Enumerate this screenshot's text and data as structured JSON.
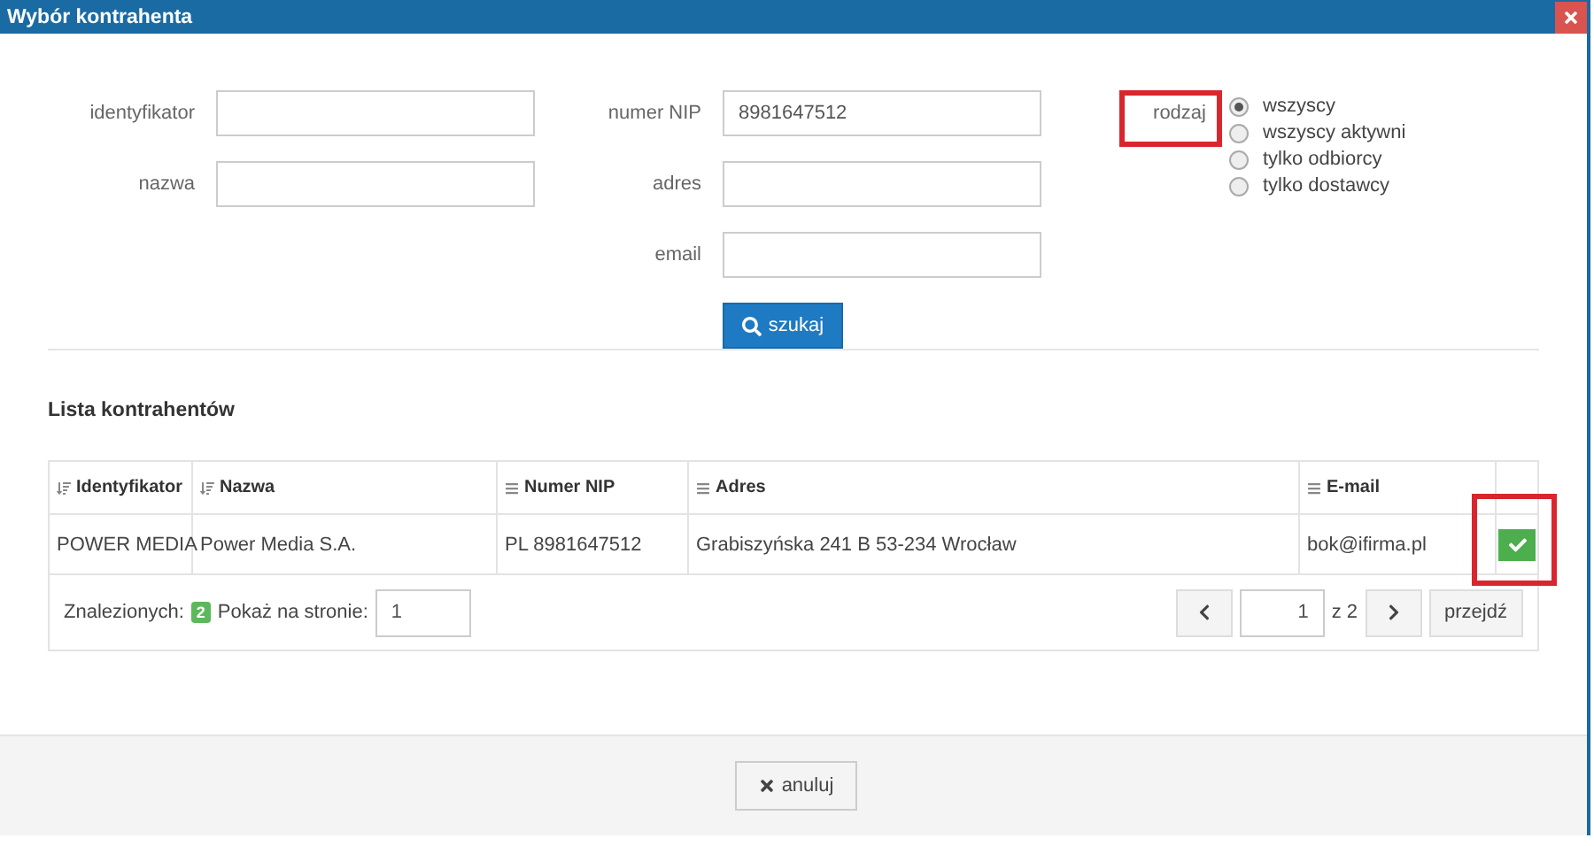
{
  "window": {
    "title": "Wybór kontrahenta"
  },
  "filters": {
    "left": [
      {
        "label": "identyfikator"
      },
      {
        "label": "nazwa"
      }
    ],
    "middle": [
      {
        "label": "numer NIP",
        "value": "8981647512"
      },
      {
        "label": "adres"
      },
      {
        "label": "email"
      }
    ],
    "search_button": "szukaj",
    "kind": {
      "label": "rodzaj",
      "highlighted": true,
      "options": [
        {
          "label": "wszyscy",
          "selected": true
        },
        {
          "label": "wszyscy aktywni",
          "selected": false
        },
        {
          "label": "tylko odbiorcy",
          "selected": false
        },
        {
          "label": "tylko dostawcy",
          "selected": false
        }
      ]
    }
  },
  "section_title": "Lista kontrahentów",
  "table": {
    "columns": [
      {
        "label": "Identyfikator",
        "kind": "sort"
      },
      {
        "label": "Nazwa",
        "kind": "sort"
      },
      {
        "label": "Numer NIP",
        "kind": "list"
      },
      {
        "label": "Adres",
        "kind": "list"
      },
      {
        "label": "E-mail",
        "kind": "list"
      }
    ],
    "rows": [
      {
        "cells": [
          "POWER MEDIA",
          "Power Media S.A.",
          "PL 8981647512",
          "Grabiszyńska 241 B 53-234 Wrocław",
          "bok@ifirma.pl"
        ],
        "select_highlighted": true
      }
    ]
  },
  "pager": {
    "found_label": "Znalezionych:",
    "found_count": "2",
    "per_page_label": "Pokaż na stronie:",
    "per_page": "1",
    "page": "1",
    "of": "z 2",
    "go": "przejdź"
  },
  "cancel_button": "anuluj"
}
